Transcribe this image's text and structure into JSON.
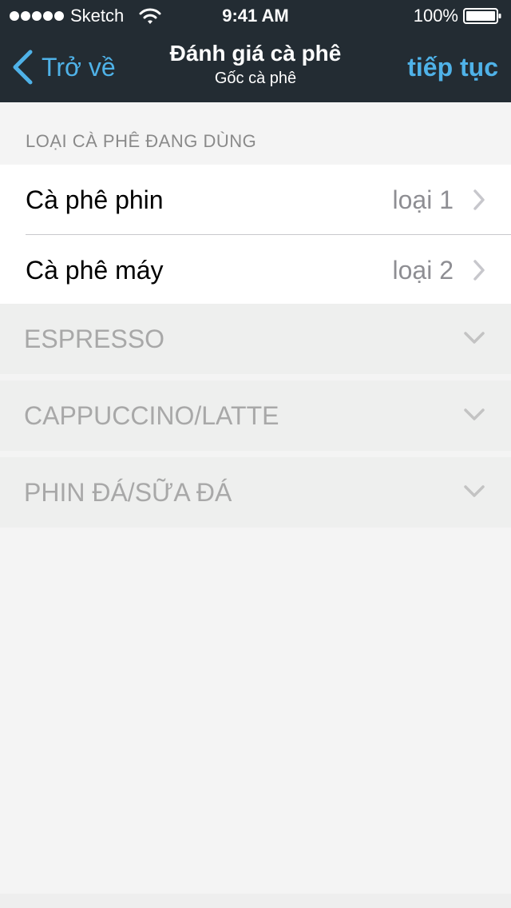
{
  "status_bar": {
    "carrier": "Sketch",
    "time": "9:41 AM",
    "battery_percent": "100%",
    "signal_icon": "signal-dots-icon",
    "wifi_icon": "wifi-icon",
    "battery_icon": "battery-icon"
  },
  "nav": {
    "back_label": "Trở về",
    "back_icon": "chevron-left-icon",
    "title": "Đánh giá cà phê",
    "subtitle": "Gốc cà phê",
    "next_label": "tiếp tục"
  },
  "section": {
    "header": "LOẠI CÀ PHÊ ĐANG DÙNG",
    "rows": [
      {
        "label": "Cà phê phin",
        "value": "loại 1",
        "icon": "chevron-right-icon"
      },
      {
        "label": "Cà phê máy",
        "value": "loại 2",
        "icon": "chevron-right-icon"
      }
    ]
  },
  "accordions": [
    {
      "label": "ESPRESSO",
      "icon": "chevron-down-icon"
    },
    {
      "label": "CAPPUCCINO/LATTE",
      "icon": "chevron-down-icon"
    },
    {
      "label": "PHIN ĐÁ/SỮA ĐÁ",
      "icon": "chevron-down-icon"
    }
  ],
  "colors": {
    "header_bg": "#232c33",
    "accent": "#4fb2e8",
    "page_bg": "#f4f4f4",
    "accordion_bg": "#eeefee",
    "muted_text": "#a8a8a8"
  }
}
